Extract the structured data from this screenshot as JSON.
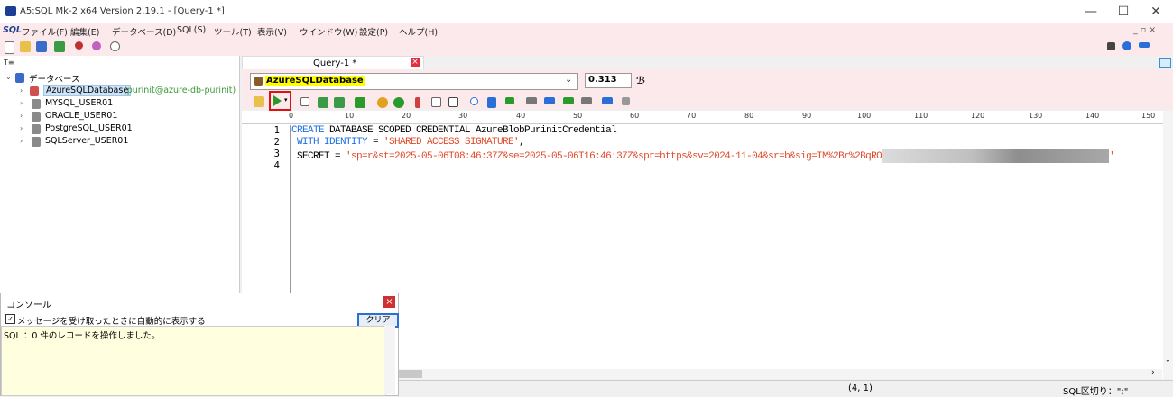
{
  "window": {
    "title": "A5:SQL Mk-2 x64 Version 2.19.1 - [Query-1 *]",
    "minimize": "—",
    "maximize": "☐",
    "close": "✕"
  },
  "menu": [
    "SQL",
    "ファイル(F)",
    "編集(E)",
    "データベース(D)",
    "SQL(S)",
    "ツール(T)",
    "表示(V)",
    "ウインドウ(W)",
    "設定(P)",
    "ヘルプ(H)"
  ],
  "tree": {
    "root": "データベース",
    "items": [
      {
        "label": "AzureSQLDatabase",
        "note": "(purinit@azure-db-purinit)"
      },
      {
        "label": "MYSQL_USER01"
      },
      {
        "label": "ORACLE_USER01"
      },
      {
        "label": "PostgreSQL_USER01"
      },
      {
        "label": "SQLServer_USER01"
      }
    ]
  },
  "query_tab": {
    "label": "Query-1 *",
    "close": "×"
  },
  "db_select": {
    "value": "AzureSQLDatabase"
  },
  "version_box": "0.313",
  "ruler": [
    "0",
    "10",
    "20",
    "30",
    "40",
    "50",
    "60",
    "70",
    "80",
    "90",
    "100",
    "110",
    "120",
    "130",
    "140",
    "150"
  ],
  "editor": {
    "line_numbers": [
      "1",
      "2",
      "3",
      "4"
    ],
    "line1": {
      "kw": "CREATE",
      "rest": " DATABASE SCOPED CREDENTIAL AzureBlobPurinitCredential"
    },
    "line2": {
      "kw": " WITH IDENTITY",
      "eq": " = ",
      "str": "'SHARED ACCESS SIGNATURE'",
      "end": ","
    },
    "line3": {
      "pre": " SECRET = ",
      "str": "'sp=r&st=2025-05-06T08:46:37Z&se=2025-05-06T16:46:37Z&spr=https&sv=2024-11-04&sr=b&sig=IM%2Br%2BqRO",
      "end": "'"
    }
  },
  "console": {
    "title": "コンソール",
    "checkbox_label": "メッセージを受け取ったときに自動的に表示する",
    "checkbox_checked": true,
    "clear_button": "クリア",
    "message": "SQL ：0 件のレコードを操作しました。",
    "close": "×"
  },
  "status": {
    "cursor": "(4, 1)",
    "sql_separator": "SQL区切り：\";\""
  },
  "colors": {
    "menu_bg": "#fbe9ec",
    "keyword": "#1e6fe0",
    "string": "#e04a2a",
    "highlight": "#ffff00"
  }
}
